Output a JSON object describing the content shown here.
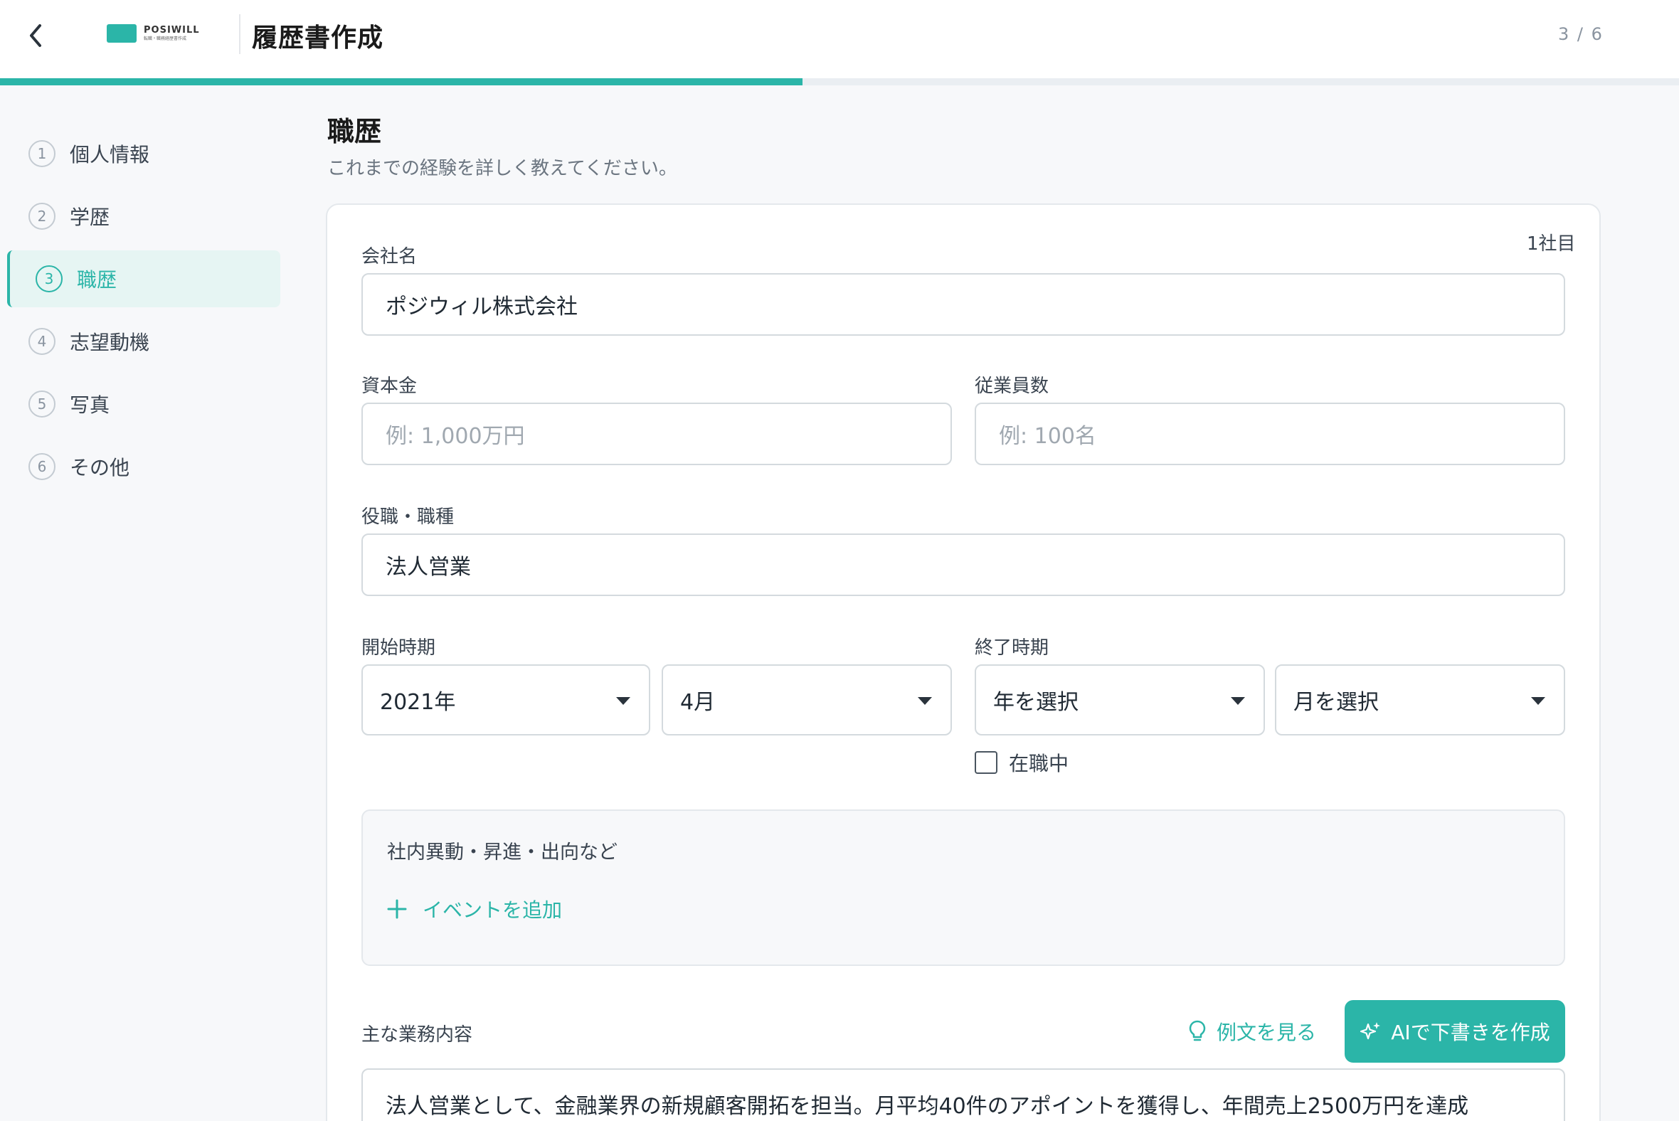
{
  "header": {
    "logo_name": "POSIWILL",
    "logo_sub": "転職・職務経歴書作成",
    "title": "履歴書作成",
    "step_counter": "3 / 6",
    "progress": 0.478
  },
  "sidebar": {
    "items": [
      {
        "num": "1",
        "label": "個人情報"
      },
      {
        "num": "2",
        "label": "学歴"
      },
      {
        "num": "3",
        "label": "職歴",
        "active": true
      },
      {
        "num": "4",
        "label": "志望動機"
      },
      {
        "num": "5",
        "label": "写真"
      },
      {
        "num": "6",
        "label": "その他"
      }
    ]
  },
  "main": {
    "title": "職歴",
    "subtitle": "これまでの経験を詳しく教えてください。",
    "company_count": "1社目",
    "company": {
      "label": "会社名",
      "value": "ポジウィル株式会社"
    },
    "capital": {
      "label": "資本金",
      "placeholder": "例: 1,000万円"
    },
    "employees": {
      "label": "従業員数",
      "placeholder": "例: 100名"
    },
    "position": {
      "label": "役職・職種",
      "value": "法人営業"
    },
    "start": {
      "label": "開始時期",
      "year": "2021年",
      "month": "4月"
    },
    "end": {
      "label": "終了時期",
      "year": "年を選択",
      "month": "月を選択"
    },
    "current_job": {
      "label": "在職中",
      "checked": false
    },
    "events": {
      "title": "社内異動・昇進・出向など",
      "add_label": "イベントを追加"
    },
    "duties": {
      "label": "主な業務内容",
      "example_label": "例文を見る",
      "ai_label": "AIで下書きを作成",
      "value": "法人営業として、金融業界の新規顧客開拓を担当。月平均40件のアポイントを獲得し、年間売上2500万円を達成"
    }
  },
  "colors": {
    "accent": "#2bb5a8"
  }
}
